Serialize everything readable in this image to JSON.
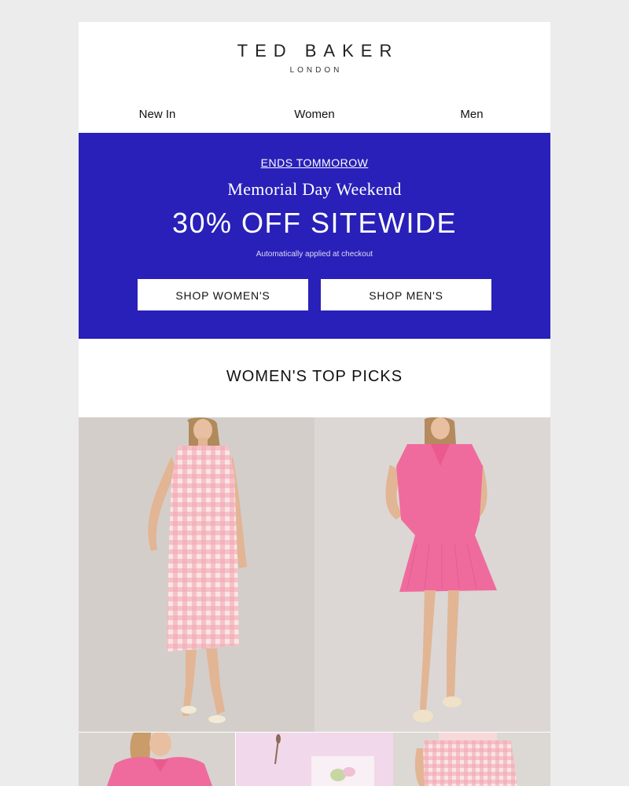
{
  "brand": {
    "name": "TED BAKER",
    "sub": "LONDON"
  },
  "nav": {
    "items": [
      "New In",
      "Women",
      "Men"
    ]
  },
  "banner": {
    "ends": "ENDS TOMMOROW",
    "headline": "Memorial Day Weekend",
    "offer": "30% OFF SITEWIDE",
    "fine_print": "Automatically applied at checkout",
    "shop_women": "SHOP WOMEN'S",
    "shop_men": "SHOP MEN'S",
    "color": "#2820b8"
  },
  "section": {
    "title": "WOMEN'S TOP PICKS"
  },
  "products": [
    {
      "desc_icon": "gingham-dress-image"
    },
    {
      "desc_icon": "pink-knit-dress-image"
    },
    {
      "desc_icon": "pink-knit-top-image"
    },
    {
      "desc_icon": "floral-still-life-image"
    },
    {
      "desc_icon": "gingham-skirt-image"
    }
  ]
}
